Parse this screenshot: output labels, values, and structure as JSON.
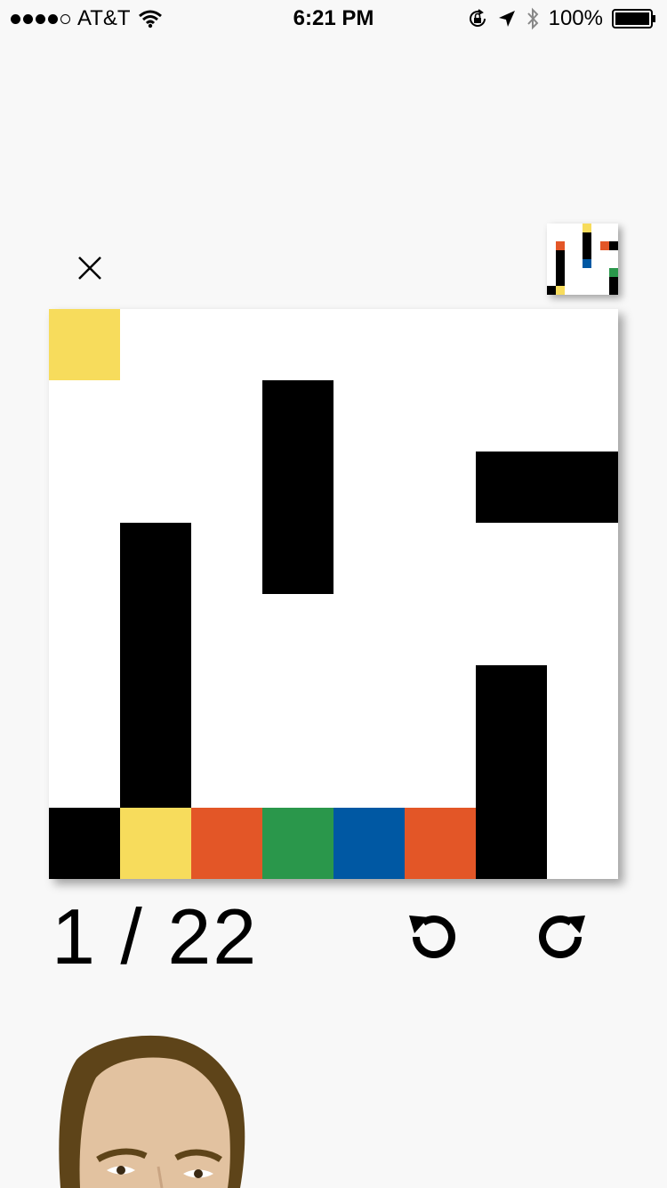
{
  "status_bar": {
    "carrier": "AT&T",
    "time": "6:21 PM",
    "battery": "100%"
  },
  "game": {
    "level_current": "1",
    "level_separator": "/",
    "level_total": "22",
    "colors": {
      "yellow": "#f7dc5c",
      "orange": "#e35627",
      "green": "#2a974b",
      "blue": "#0058a3",
      "black": "#000000",
      "white": "#ffffff"
    },
    "grid_size": 8,
    "board_cells": [
      {
        "col": 0,
        "row": 0,
        "w": 1,
        "h": 1,
        "color": "yellow"
      },
      {
        "col": 3,
        "row": 1,
        "w": 1,
        "h": 3,
        "color": "black"
      },
      {
        "col": 6,
        "row": 2,
        "w": 2,
        "h": 1,
        "color": "black"
      },
      {
        "col": 1,
        "row": 3,
        "w": 1,
        "h": 4,
        "color": "black"
      },
      {
        "col": 6,
        "row": 5,
        "w": 1,
        "h": 3,
        "color": "black"
      },
      {
        "col": 0,
        "row": 7,
        "w": 1,
        "h": 1,
        "color": "black"
      },
      {
        "col": 1,
        "row": 7,
        "w": 1,
        "h": 1,
        "color": "yellow"
      },
      {
        "col": 2,
        "row": 7,
        "w": 1,
        "h": 1,
        "color": "orange"
      },
      {
        "col": 3,
        "row": 7,
        "w": 1,
        "h": 1,
        "color": "green"
      },
      {
        "col": 4,
        "row": 7,
        "w": 1,
        "h": 1,
        "color": "blue"
      },
      {
        "col": 5,
        "row": 7,
        "w": 1,
        "h": 1,
        "color": "orange"
      }
    ],
    "target_cells": [
      {
        "col": 0,
        "row": 7,
        "w": 1,
        "h": 1,
        "color": "black"
      },
      {
        "col": 1,
        "row": 7,
        "w": 1,
        "h": 1,
        "color": "yellow"
      },
      {
        "col": 1,
        "row": 2,
        "w": 1,
        "h": 5,
        "color": "black"
      },
      {
        "col": 1,
        "row": 2,
        "w": 1,
        "h": 1,
        "color": "orange"
      },
      {
        "col": 4,
        "row": 0,
        "w": 1,
        "h": 1,
        "color": "yellow"
      },
      {
        "col": 4,
        "row": 1,
        "w": 1,
        "h": 3,
        "color": "black"
      },
      {
        "col": 4,
        "row": 4,
        "w": 1,
        "h": 1,
        "color": "blue"
      },
      {
        "col": 6,
        "row": 2,
        "w": 1,
        "h": 1,
        "color": "orange"
      },
      {
        "col": 7,
        "row": 2,
        "w": 2,
        "h": 1,
        "color": "black"
      },
      {
        "col": 7,
        "row": 5,
        "w": 1,
        "h": 1,
        "color": "green"
      },
      {
        "col": 7,
        "row": 6,
        "w": 1,
        "h": 3,
        "color": "black"
      }
    ],
    "icons": {
      "close": "close-icon",
      "undo": "undo-icon",
      "redo": "redo-icon"
    }
  }
}
